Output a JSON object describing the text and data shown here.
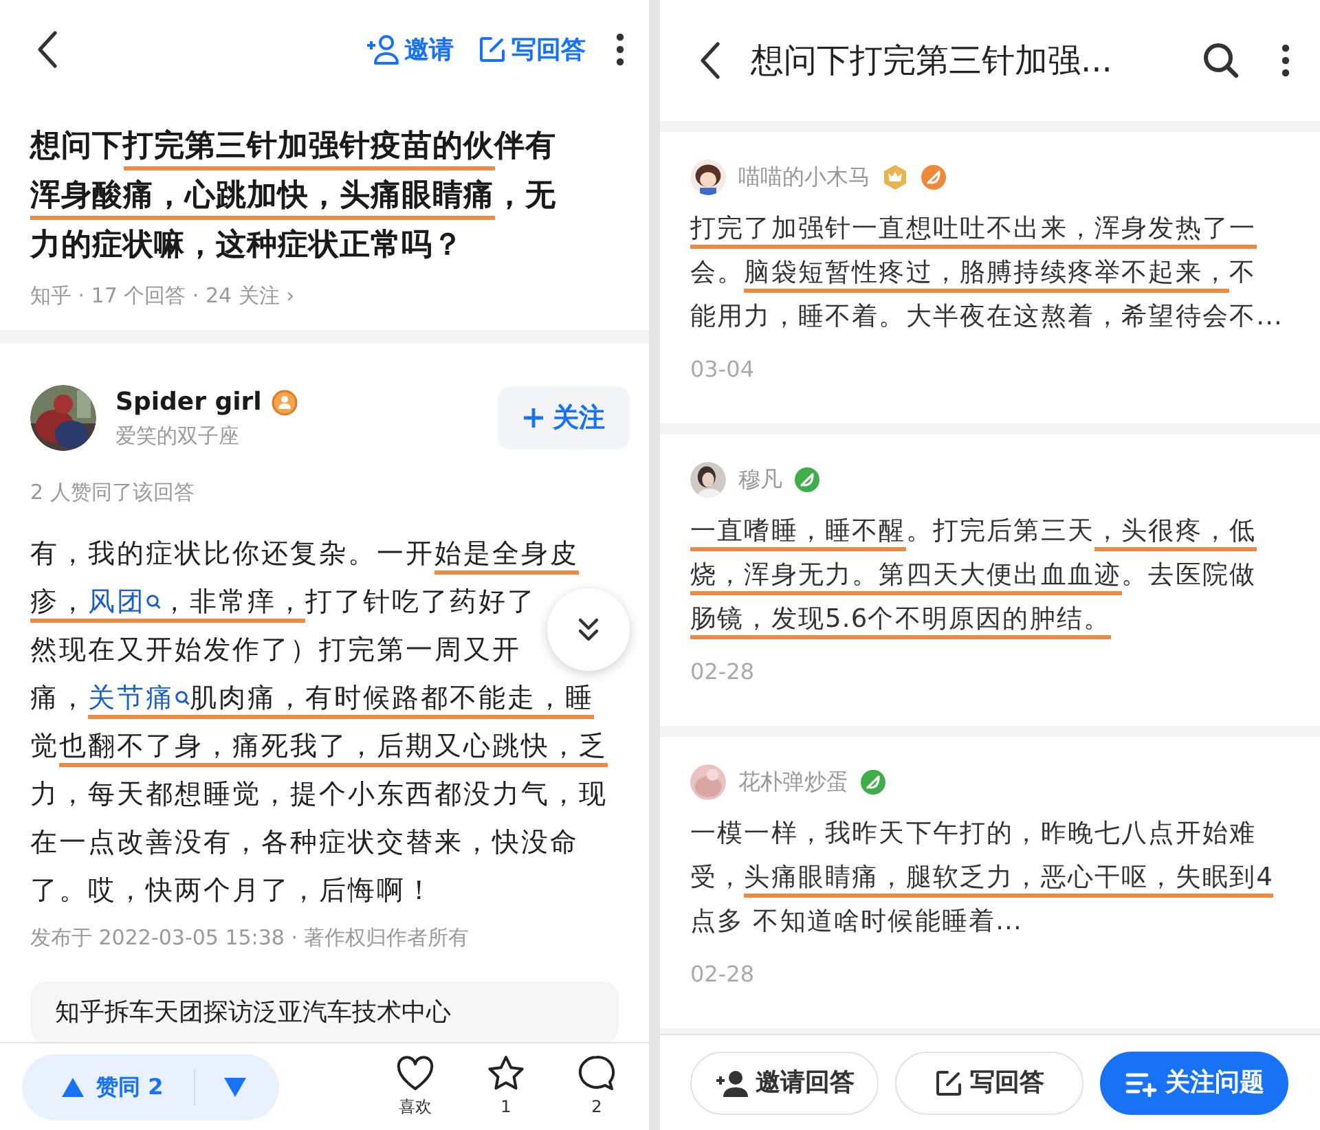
{
  "left_screen": {
    "top_bar": {
      "actions": [
        {
          "kind": "invite",
          "label": "邀请"
        },
        {
          "kind": "write",
          "label": "写回答"
        }
      ]
    },
    "question": {
      "title_lines": [
        [
          {
            "text": "想问下",
            "underlined": false
          },
          {
            "text": "打完第三针加强针疫苗的伙",
            "underlined": true
          },
          {
            "text": "伴有",
            "underlined": false
          }
        ],
        [
          {
            "text": "浑身酸痛，心跳加快，头痛眼睛痛",
            "underlined": true
          },
          {
            "text": "，无",
            "underlined": false
          }
        ],
        [
          {
            "text": "力的症状嘛，这种症状正常吗？",
            "underlined": false
          }
        ]
      ],
      "meta": "知乎 · 17 个回答 · 24 关注 ›"
    },
    "answer": {
      "author": "Spider girl",
      "bio": "爱笑的双子座",
      "follow_button": "关注",
      "upvote_summary": "2 人赞同了该回答",
      "body_lines": [
        [
          {
            "kind": "text",
            "text": "有，我的症状比你还复杂。一开",
            "underlined": false
          },
          {
            "kind": "text",
            "text": "始是全身皮",
            "underlined": true
          }
        ],
        [
          {
            "kind": "text",
            "text": "疹，",
            "underlined": true
          },
          {
            "kind": "link",
            "text": "风团",
            "underlined": true
          },
          {
            "kind": "text",
            "text": "，非常痒，",
            "underlined": true
          },
          {
            "kind": "text",
            "text": "打了针吃了药好了",
            "underlined": false
          }
        ],
        [
          {
            "kind": "text",
            "text": "然现在又开始发作了）打完第一周又开",
            "underlined": false
          }
        ],
        [
          {
            "kind": "text",
            "text": "痛，",
            "underlined": false
          },
          {
            "kind": "link",
            "text": "关节痛",
            "underlined": true
          },
          {
            "kind": "text",
            "text": "肌肉痛，有时候路都不能走，睡",
            "underlined": true
          }
        ],
        [
          {
            "kind": "text",
            "text": "觉",
            "underlined": false
          },
          {
            "kind": "text",
            "text": "也翻不了身，痛死我了，后期又心跳快，乏",
            "underlined": true
          }
        ],
        [
          {
            "kind": "text",
            "text": "力，每天都想睡觉，提个小东西都没力气，现",
            "underlined": false
          }
        ],
        [
          {
            "kind": "text",
            "text": "在一点改善没有，各种症状交替来，快没命",
            "underlined": false
          }
        ],
        [
          {
            "kind": "text",
            "text": "了。哎，快两个月了，后悔啊！",
            "underlined": false
          }
        ]
      ],
      "published": "发布于 2022-03-05 15:38 · 著作权归作者所有"
    },
    "related_card": {
      "title": "知乎拆车天团探访泛亚汽车技术中心"
    },
    "bottom_bar": {
      "vote_label": "赞同 2",
      "actions": [
        {
          "kind": "like",
          "label": "喜欢"
        },
        {
          "kind": "favorite",
          "label": "1"
        },
        {
          "kind": "comment",
          "label": "2"
        }
      ]
    }
  },
  "right_screen": {
    "top_bar": {
      "title": "想问下打完第三针加强..."
    },
    "comments": [
      {
        "author": "喵喵的小木马",
        "badges": [
          {
            "kind": "hexagon",
            "color": "#e6b552"
          },
          {
            "kind": "circle",
            "color": "#f0883a"
          }
        ],
        "body_lines": [
          [
            {
              "text": "打完了加强针一直想吐吐不出来，浑身发热了一",
              "underlined": true
            }
          ],
          [
            {
              "text": "会。",
              "underlined": false
            },
            {
              "text": "脑袋短暂性疼过，胳膊持续疼举不起来，",
              "underlined": true
            },
            {
              "text": "不",
              "underlined": false
            }
          ],
          [
            {
              "text": "能用力，睡不着。大半夜在这熬着，希望待会不...",
              "underlined": false
            }
          ]
        ],
        "date": "03-04"
      },
      {
        "author": "穆凡",
        "badges": [
          {
            "kind": "circle",
            "color": "#3fae4a"
          }
        ],
        "body_lines": [
          [
            {
              "text": "一直嗜睡，睡不醒",
              "underlined": true
            },
            {
              "text": "。打完后第三天",
              "underlined": false
            },
            {
              "text": "，头很疼，低",
              "underlined": true
            }
          ],
          [
            {
              "text": "烧，浑身无力。第四天大便出血血迹",
              "underlined": true
            },
            {
              "text": "。去医院做",
              "underlined": false
            }
          ],
          [
            {
              "text": "肠镜，发现5.6个不明原因的肿结。",
              "underlined": true
            }
          ]
        ],
        "date": "02-28"
      },
      {
        "author": "花朴弹炒蛋",
        "badges": [
          {
            "kind": "circle",
            "color": "#3fae4a"
          }
        ],
        "body_lines": [
          [
            {
              "text": "一模一样，我昨天下午打的，昨晚七八点开始难",
              "underlined": false
            }
          ],
          [
            {
              "text": "受，",
              "underlined": false
            },
            {
              "text": "头痛眼睛痛，腿软乏力，恶心干呕，失眠到4",
              "underlined": true
            }
          ],
          [
            {
              "text": "点多 不知道啥时候能睡着...",
              "underlined": false
            }
          ]
        ],
        "date": "02-28"
      }
    ],
    "bottom_buttons": [
      {
        "kind": "invite",
        "label": "邀请回答",
        "primary": false
      },
      {
        "kind": "write",
        "label": "写回答",
        "primary": false
      },
      {
        "kind": "follow",
        "label": "关注问题",
        "primary": true
      }
    ]
  }
}
